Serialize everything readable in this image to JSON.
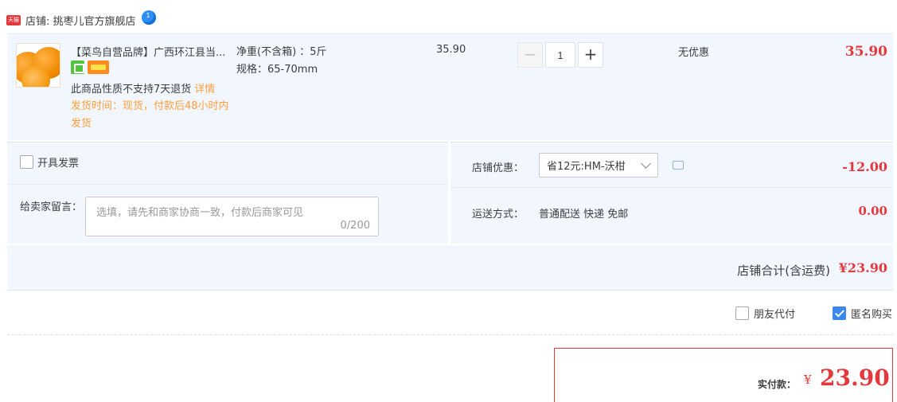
{
  "shop": {
    "label": "店铺: 挑枣儿官方旗舰店",
    "badge": "天猫"
  },
  "item": {
    "title": "【菜鸟自营品牌】广西环江县当...",
    "note": "此商品性质不支持7天退货",
    "detail_link": "详情",
    "ship_time": "发货时间：现货，付款后48小时内发货",
    "sku_weight": "净重(不含箱) ：5斤",
    "sku_spec": "规格：65-70mm",
    "unit_price": "35.90",
    "quantity": "1",
    "discount": "无优惠",
    "subtotal": "35.90"
  },
  "invoice": {
    "label": "开具发票"
  },
  "message": {
    "label": "给卖家留言：",
    "placeholder": "选填，请先和商家协商一致，付款后商家可见",
    "count": "0/200"
  },
  "promo": {
    "label": "店铺优惠：",
    "selected": "省12元:HM-沃柑",
    "amount": "-12.00"
  },
  "shipping": {
    "label": "运送方式：",
    "method": "普通配送 快递 免邮",
    "amount": "0.00"
  },
  "total": {
    "label": "店铺合计(含运费)",
    "value": "¥23.90"
  },
  "options": {
    "friend_pay": "朋友代付",
    "anonymous": "匿名购买",
    "anonymous_checked": true
  },
  "payment": {
    "label": "实付款：",
    "yen": "¥",
    "value": "23.90"
  },
  "colors": {
    "price_red": "#e4393c",
    "row_bg": "#f2f7ff",
    "accent_blue": "#3a87ef",
    "orange_text": "#ff9e3d"
  }
}
